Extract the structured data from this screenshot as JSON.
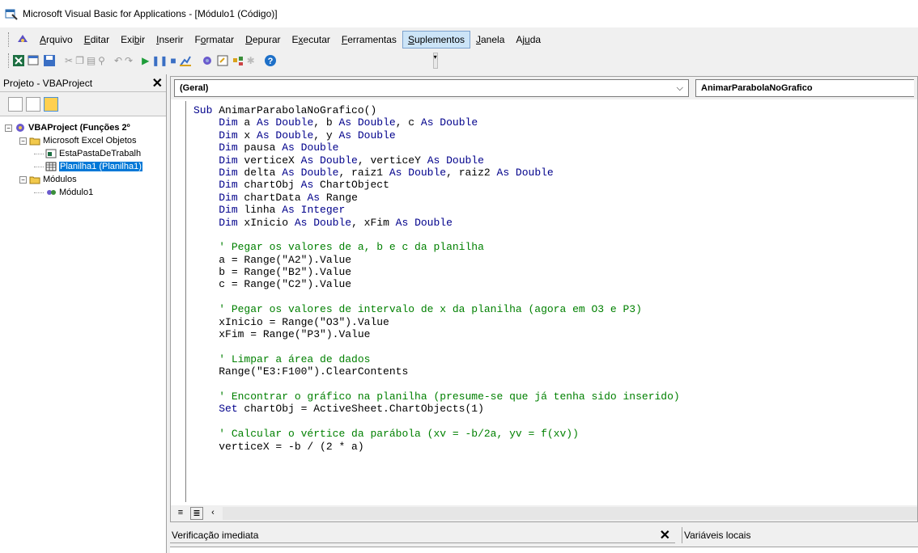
{
  "window": {
    "title": "Microsoft Visual Basic for Applications - [Módulo1 (Código)]"
  },
  "menu": [
    {
      "pre": "",
      "key": "A",
      "post": "rquivo"
    },
    {
      "pre": "",
      "key": "E",
      "post": "ditar"
    },
    {
      "pre": "Exi",
      "key": "b",
      "post": "ir"
    },
    {
      "pre": "",
      "key": "I",
      "post": "nserir"
    },
    {
      "pre": "F",
      "key": "o",
      "post": "rmatar"
    },
    {
      "pre": "",
      "key": "D",
      "post": "epurar"
    },
    {
      "pre": "E",
      "key": "x",
      "post": "ecutar"
    },
    {
      "pre": "",
      "key": "F",
      "post": "erramentas"
    },
    {
      "pre": "",
      "key": "S",
      "post": "uplementos",
      "active": true
    },
    {
      "pre": "",
      "key": "J",
      "post": "anela"
    },
    {
      "pre": "Aj",
      "key": "u",
      "post": "da"
    }
  ],
  "toolbar": {
    "icons": [
      "excel-icon",
      "insert-userform-icon",
      "save-icon",
      "cut-icon",
      "copy-icon",
      "paste-icon",
      "find-icon",
      "undo-icon",
      "redo-icon",
      "run-icon",
      "break-icon",
      "reset-icon",
      "design-mode-icon",
      "project-explorer-icon",
      "properties-icon",
      "object-browser-icon",
      "toolbox-icon",
      "help-icon"
    ]
  },
  "project_panel": {
    "title": "Projeto - VBAProject",
    "tree": [
      {
        "label": "VBAProject (Funções 2º",
        "level": 0,
        "bold": true,
        "expander": "−",
        "icon": "vbaproject-icon"
      },
      {
        "label": "Microsoft Excel Objetos",
        "level": 1,
        "expander": "−",
        "icon": "folder-icon"
      },
      {
        "label": "EstaPastaDeTrabalh",
        "level": 2,
        "icon": "workbook-icon"
      },
      {
        "label": "Planilha1 (Planilha1)",
        "level": 2,
        "icon": "worksheet-icon",
        "selected": true
      },
      {
        "label": "Módulos",
        "level": 1,
        "expander": "−",
        "icon": "folder-icon"
      },
      {
        "label": "Módulo1",
        "level": 2,
        "icon": "module-icon"
      }
    ]
  },
  "code_window": {
    "object_combo": "(Geral)",
    "procedure_combo": "AnimarParabolaNoGrafico",
    "lines": [
      {
        "indent": 0,
        "parts": [
          {
            "t": "Sub",
            "c": "kw"
          },
          {
            "t": " AnimarParabolaNoGrafico()"
          }
        ]
      },
      {
        "indent": 1,
        "parts": [
          {
            "t": "Dim",
            "c": "kw"
          },
          {
            "t": " a "
          },
          {
            "t": "As Double",
            "c": "kw"
          },
          {
            "t": ", b "
          },
          {
            "t": "As Double",
            "c": "kw"
          },
          {
            "t": ", c "
          },
          {
            "t": "As Double",
            "c": "kw"
          }
        ]
      },
      {
        "indent": 1,
        "parts": [
          {
            "t": "Dim",
            "c": "kw"
          },
          {
            "t": " x "
          },
          {
            "t": "As Double",
            "c": "kw"
          },
          {
            "t": ", y "
          },
          {
            "t": "As Double",
            "c": "kw"
          }
        ]
      },
      {
        "indent": 1,
        "parts": [
          {
            "t": "Dim",
            "c": "kw"
          },
          {
            "t": " pausa "
          },
          {
            "t": "As Double",
            "c": "kw"
          }
        ]
      },
      {
        "indent": 1,
        "parts": [
          {
            "t": "Dim",
            "c": "kw"
          },
          {
            "t": " verticeX "
          },
          {
            "t": "As Double",
            "c": "kw"
          },
          {
            "t": ", verticeY "
          },
          {
            "t": "As Double",
            "c": "kw"
          }
        ]
      },
      {
        "indent": 1,
        "parts": [
          {
            "t": "Dim",
            "c": "kw"
          },
          {
            "t": " delta "
          },
          {
            "t": "As Double",
            "c": "kw"
          },
          {
            "t": ", raiz1 "
          },
          {
            "t": "As Double",
            "c": "kw"
          },
          {
            "t": ", raiz2 "
          },
          {
            "t": "As Double",
            "c": "kw"
          }
        ]
      },
      {
        "indent": 1,
        "parts": [
          {
            "t": "Dim",
            "c": "kw"
          },
          {
            "t": " chartObj "
          },
          {
            "t": "As",
            "c": "kw"
          },
          {
            "t": " ChartObject"
          }
        ]
      },
      {
        "indent": 1,
        "parts": [
          {
            "t": "Dim",
            "c": "kw"
          },
          {
            "t": " chartData "
          },
          {
            "t": "As",
            "c": "kw"
          },
          {
            "t": " Range"
          }
        ]
      },
      {
        "indent": 1,
        "parts": [
          {
            "t": "Dim",
            "c": "kw"
          },
          {
            "t": " linha "
          },
          {
            "t": "As Integer",
            "c": "kw"
          }
        ]
      },
      {
        "indent": 1,
        "parts": [
          {
            "t": "Dim",
            "c": "kw"
          },
          {
            "t": " xInicio "
          },
          {
            "t": "As Double",
            "c": "kw"
          },
          {
            "t": ", xFim "
          },
          {
            "t": "As Double",
            "c": "kw"
          }
        ]
      },
      {
        "indent": 0,
        "parts": []
      },
      {
        "indent": 1,
        "parts": [
          {
            "t": "' Pegar os valores de a, b e c da planilha",
            "c": "cm"
          }
        ]
      },
      {
        "indent": 1,
        "parts": [
          {
            "t": "a = Range(\"A2\").Value"
          }
        ]
      },
      {
        "indent": 1,
        "parts": [
          {
            "t": "b = Range(\"B2\").Value"
          }
        ]
      },
      {
        "indent": 1,
        "parts": [
          {
            "t": "c = Range(\"C2\").Value"
          }
        ]
      },
      {
        "indent": 0,
        "parts": []
      },
      {
        "indent": 1,
        "parts": [
          {
            "t": "' Pegar os valores de intervalo de x da planilha (agora em O3 e P3)",
            "c": "cm"
          }
        ]
      },
      {
        "indent": 1,
        "parts": [
          {
            "t": "xInicio = Range(\"O3\").Value"
          }
        ]
      },
      {
        "indent": 1,
        "parts": [
          {
            "t": "xFim = Range(\"P3\").Value"
          }
        ]
      },
      {
        "indent": 0,
        "parts": []
      },
      {
        "indent": 1,
        "parts": [
          {
            "t": "' Limpar a área de dados",
            "c": "cm"
          }
        ]
      },
      {
        "indent": 1,
        "parts": [
          {
            "t": "Range(\"E3:F100\").ClearContents"
          }
        ]
      },
      {
        "indent": 0,
        "parts": []
      },
      {
        "indent": 1,
        "parts": [
          {
            "t": "' Encontrar o gráfico na planilha (presume-se que já tenha sido inserido)",
            "c": "cm"
          }
        ]
      },
      {
        "indent": 1,
        "parts": [
          {
            "t": "Set",
            "c": "kw"
          },
          {
            "t": " chartObj = ActiveSheet.ChartObjects(1)"
          }
        ]
      },
      {
        "indent": 0,
        "parts": []
      },
      {
        "indent": 1,
        "parts": [
          {
            "t": "' Calcular o vértice da parábola (xv = -b/2a, yv = f(xv))",
            "c": "cm"
          }
        ]
      },
      {
        "indent": 1,
        "parts": [
          {
            "t": "verticeX = -b / (2 * a)"
          }
        ]
      }
    ]
  },
  "immediate": {
    "title": "Verificação imediata"
  },
  "locals": {
    "title": "Variáveis locais"
  }
}
